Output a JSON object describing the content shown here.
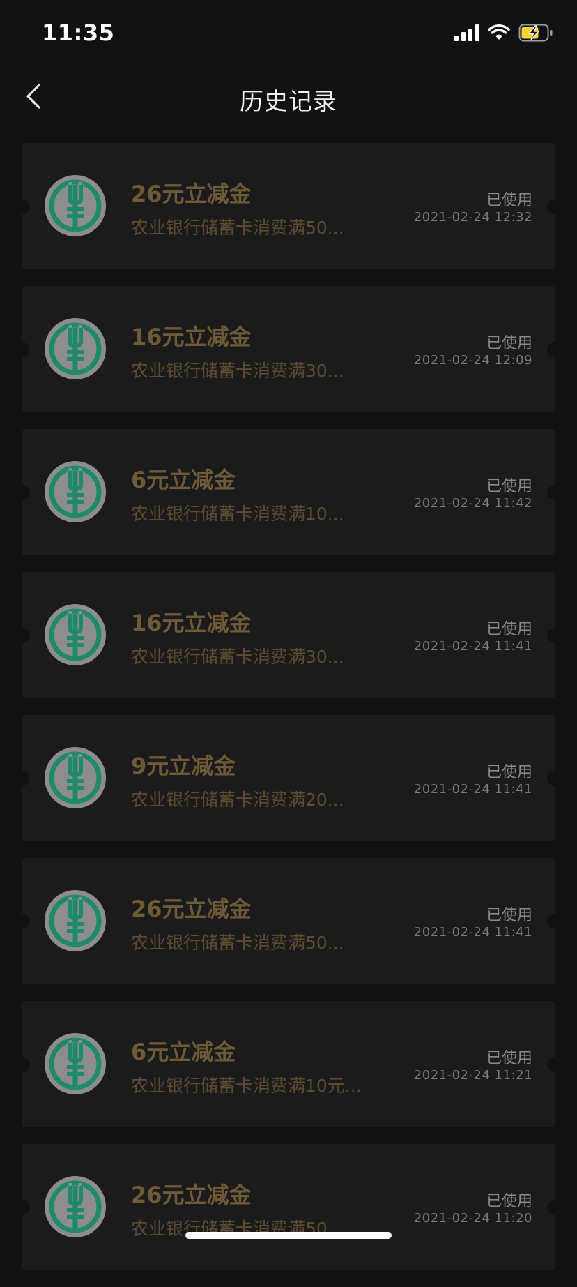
{
  "status_bar": {
    "time": "11:35"
  },
  "nav": {
    "title": "历史记录"
  },
  "colors": {
    "background": "#111111",
    "card": "#1b1b1b",
    "amount_gold": "#6f5a38",
    "logo_green": "#1f8a6b",
    "battery_yellow": "#f5d236"
  },
  "records": [
    {
      "amount": "26元立减金",
      "desc": "农业银行储蓄卡消费满50...",
      "status": "已使用",
      "time": "2021-02-24 12:32"
    },
    {
      "amount": "16元立减金",
      "desc": "农业银行储蓄卡消费满30...",
      "status": "已使用",
      "time": "2021-02-24 12:09"
    },
    {
      "amount": "6元立减金",
      "desc": "农业银行储蓄卡消费满10...",
      "status": "已使用",
      "time": "2021-02-24 11:42"
    },
    {
      "amount": "16元立减金",
      "desc": "农业银行储蓄卡消费满30...",
      "status": "已使用",
      "time": "2021-02-24 11:41"
    },
    {
      "amount": "9元立减金",
      "desc": "农业银行储蓄卡消费满20...",
      "status": "已使用",
      "time": "2021-02-24 11:41"
    },
    {
      "amount": "26元立减金",
      "desc": "农业银行储蓄卡消费满50...",
      "status": "已使用",
      "time": "2021-02-24 11:41"
    },
    {
      "amount": "6元立减金",
      "desc": "农业银行储蓄卡消费满10元...",
      "status": "已使用",
      "time": "2021-02-24 11:21"
    },
    {
      "amount": "26元立减金",
      "desc": "农业银行储蓄卡消费满50...",
      "status": "已使用",
      "time": "2021-02-24 11:20"
    }
  ]
}
